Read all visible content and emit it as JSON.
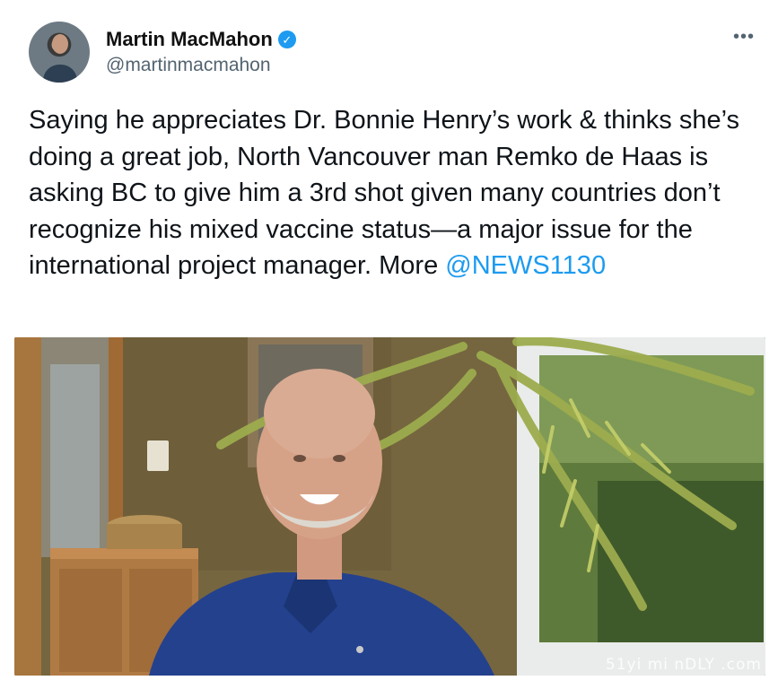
{
  "author": {
    "display_name": "Martin MacMahon",
    "handle": "@martinmacmahon",
    "verified": true
  },
  "tweet": {
    "text_before_mention": "Saying he appreciates Dr. Bonnie Henry’s work & thinks she’s doing a great job, North Vancouver man Remko de Haas is asking BC to give him a 3rd shot given many countries don’t recognize his mixed vaccine status—a major issue for the international project manager. More ",
    "mention": "@NEWS1130"
  },
  "menu": {
    "more_label": "•••"
  },
  "verified_badge": "✓",
  "watermark": "51yi mi nDLY .com",
  "colors": {
    "accent": "#1d9bf0",
    "text": "#0f1419",
    "secondary": "#536471"
  }
}
